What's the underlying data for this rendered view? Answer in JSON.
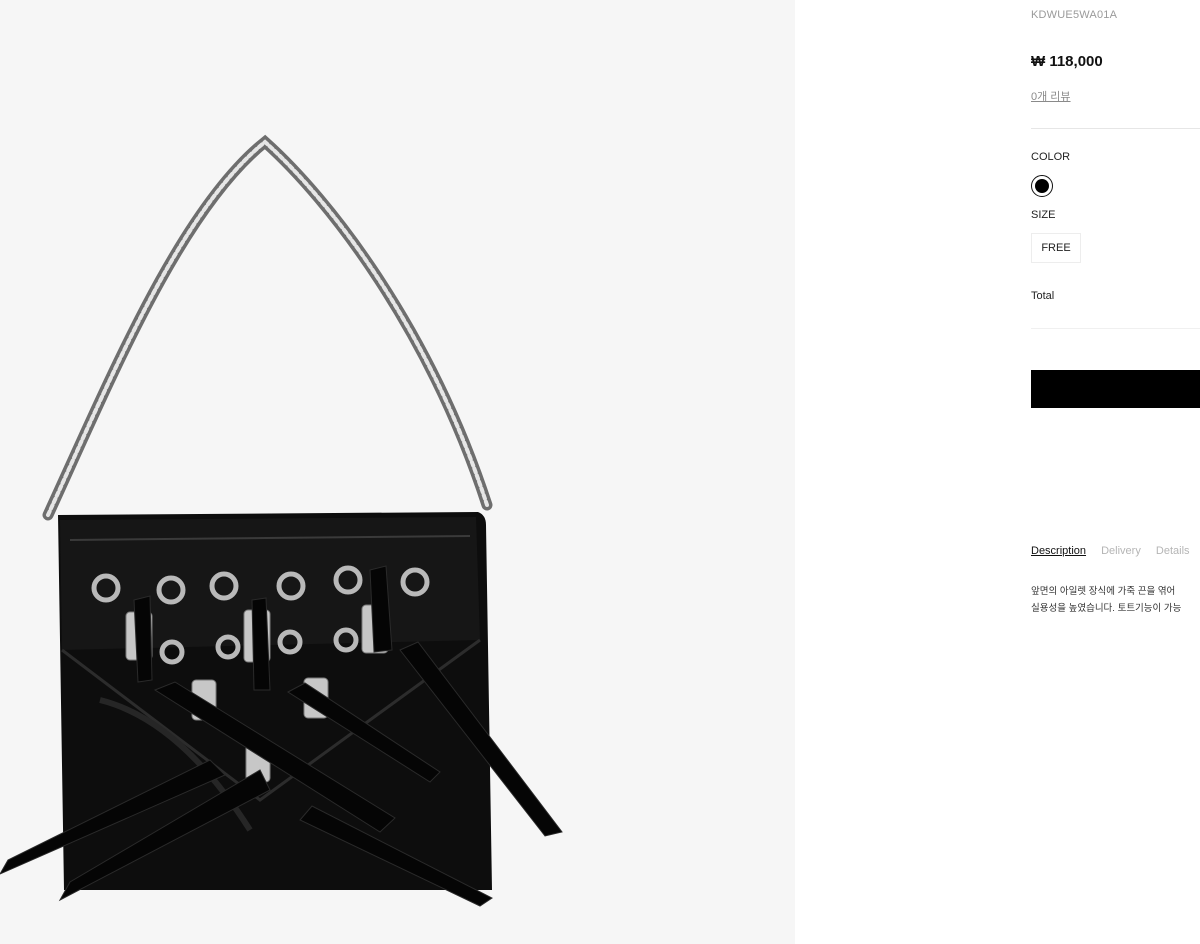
{
  "product": {
    "sku": "KDWUE5WA01A",
    "price": "₩ 118,000",
    "reviews": "0개 리뷰"
  },
  "options": {
    "color_label": "COLOR",
    "color_value": "#000000",
    "size_label": "SIZE",
    "size_value": "FREE"
  },
  "total": {
    "label": "Total"
  },
  "tabs": [
    {
      "label": "Description",
      "active": true
    },
    {
      "label": "Delivery",
      "active": false
    },
    {
      "label": "Details",
      "active": false
    }
  ],
  "description": {
    "line1": "앞면의 아일렛 장식에 가죽 끈을 엮어",
    "line2": "실용성을 높였습니다. 토트기능이 가능"
  },
  "colors": {
    "background_image": "#f6f6f6",
    "buy_button": "#000000"
  }
}
